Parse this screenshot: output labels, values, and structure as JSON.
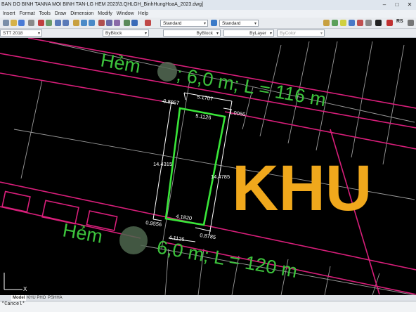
{
  "window": {
    "title": "BAN DO BINH TANNA MOI BINH TAN-LG HEM 2023\\3.QHLGH_BinhHungHoaA_2023.dwg]",
    "controls": [
      "–",
      "□",
      "✕"
    ]
  },
  "menu": [
    "Insert",
    "Format",
    "Tools",
    "Draw",
    "Dimension",
    "Modify",
    "Window",
    "Help"
  ],
  "toolbar": {
    "text_style": "Standard",
    "dim_style": "Standard",
    "extra_label": "RS"
  },
  "properties": {
    "layer": "STT 2018",
    "color": "ByBlock",
    "linetype": "ByBlock",
    "lineweight": "ByLayer",
    "plotstyle": "ByColor"
  },
  "drawing": {
    "road_top_label": "Hẻm       ; 6,0 m; L = 116 m",
    "road_top_a": "Hẻm",
    "road_top_b": "; 6,0 m; L = 116 m",
    "road_bottom_a": "Hẻm",
    "road_bottom_b": "6,0 m; L = 120 m",
    "zone_label": "KHU",
    "dims": {
      "top_outer": "5.1707",
      "top_inner": "5.1126",
      "left_top": "0.8967",
      "right_top": "1.0066",
      "left_side": "14.4315",
      "right_side": "14.4785",
      "bottom_inner": "4.1820",
      "bottom_left": "0.9556",
      "bottom_right": "0.8785",
      "bottom_outer": "4.1126"
    },
    "colors": {
      "road_text": "#3cc23c",
      "zone_text": "#f0a81c",
      "boundary": "#d81e7a",
      "lot": "#39e639",
      "dimension": "#ffffff",
      "grid": "#a9a9a9"
    },
    "axis_x": "X"
  },
  "layout_tabs": [
    "Model",
    "KHU PHO",
    "PSHHA"
  ],
  "command_line": "*Cancel*"
}
